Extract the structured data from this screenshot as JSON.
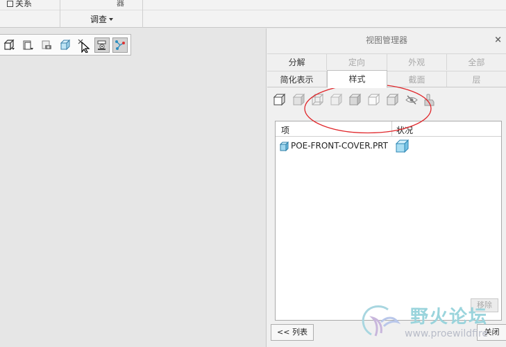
{
  "ribbon": {
    "relation_label": "关系",
    "qi_label": "器",
    "investigate_label": "调查"
  },
  "toolbar": {
    "buttons": [
      "cube-icon",
      "copy-view-icon",
      "camera-icon",
      "section-view-icon",
      "cursor-icon",
      "view-manager-icon",
      "connection-icon"
    ]
  },
  "dialog": {
    "title": "视图管理器",
    "close_glyph": "×",
    "tabs_row1": [
      "分解",
      "定向",
      "外观",
      "全部"
    ],
    "tabs_row2": [
      "简化表示",
      "样式",
      "截面",
      "层"
    ],
    "style_icons": [
      "wireframe-cube-icon",
      "shaded-cube-icon",
      "hidden-line-icon",
      "no-hidden-icon",
      "shade-edges-icon",
      "transparent-icon",
      "shaded-icon",
      "hide-eye-icon",
      "hand-icon"
    ],
    "columns": [
      "项",
      "状况"
    ],
    "rows": [
      {
        "item": "POE-FRONT-COVER.PRT"
      }
    ],
    "remove_label": "移除",
    "list_label": "<< 列表",
    "close_label": "关闭"
  },
  "watermark": {
    "title": "野火论坛",
    "url": "www.proewildfire"
  },
  "colors": {
    "annotation": "#e0262a",
    "accent_cube": "#6cc6e8"
  }
}
